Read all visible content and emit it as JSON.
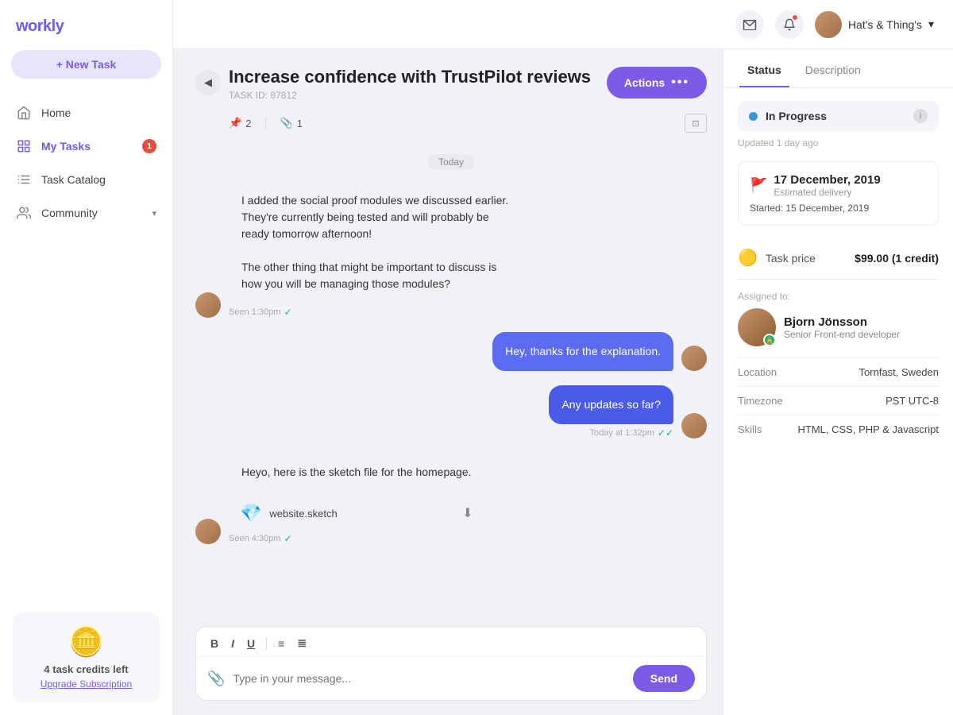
{
  "app": {
    "name": "workly"
  },
  "topbar": {
    "user_name": "Hat's & Thing's",
    "dropdown_icon": "▾"
  },
  "sidebar": {
    "new_task_label": "+ New Task",
    "nav_items": [
      {
        "id": "home",
        "label": "Home",
        "icon": "home",
        "badge": null,
        "active": false
      },
      {
        "id": "my-tasks",
        "label": "My Tasks",
        "icon": "tasks",
        "badge": "1",
        "active": true
      },
      {
        "id": "task-catalog",
        "label": "Task Catalog",
        "icon": "catalog",
        "badge": null,
        "active": false
      },
      {
        "id": "community",
        "label": "Community",
        "icon": "community",
        "badge": null,
        "active": false,
        "chevron": true
      }
    ],
    "footer": {
      "credits_count": "4",
      "credits_label": "task credits left",
      "upgrade_label": "Upgrade Subscription"
    }
  },
  "task": {
    "title": "Increase confidence with TrustPilot reviews",
    "id_label": "TASK ID: 87812",
    "pins_count": "2",
    "attachments_count": "1",
    "actions_label": "Actions"
  },
  "messages": [
    {
      "id": "msg1",
      "side": "left",
      "text": "I added the social proof modules we discussed earlier. They're currently being tested and will probably be ready tomorrow afternoon!\n\nThe other thing that might be important to discuss is how you will be managing those modules?",
      "status": "Seen 1:30pm",
      "has_check": true
    },
    {
      "id": "msg2",
      "side": "right",
      "text": "Hey, thanks for the explanation.",
      "status": null,
      "has_check": false
    },
    {
      "id": "msg3",
      "side": "right",
      "text": "Any updates so far?",
      "status": "Today at 1:32pm",
      "has_check": true
    },
    {
      "id": "msg4",
      "side": "left",
      "text": "Heyo, here is the sketch file for the homepage.",
      "file": {
        "name": "website.sketch",
        "icon": "💎"
      },
      "status": "Seen 4:30pm",
      "has_check": true
    }
  ],
  "date_separator": "Today",
  "message_input": {
    "placeholder": "Type in your message...",
    "send_label": "Send",
    "toolbar": {
      "bold": "B",
      "italic": "I",
      "underline": "U",
      "list": "≡",
      "ordered_list": "≣"
    }
  },
  "right_panel": {
    "tabs": [
      "Status",
      "Description"
    ],
    "active_tab": "Status",
    "status": {
      "label": "In Progress",
      "updated": "Updated 1 day ago"
    },
    "delivery": {
      "date": "17 December, 2019",
      "label": "Estimated delivery",
      "started_label": "Started:",
      "started_date": "15 December, 2019"
    },
    "price": {
      "label": "Task price",
      "value": "$99.00 (1 credit)"
    },
    "assigned": {
      "label": "Assigned to:",
      "name": "Bjorn Jönsson",
      "role": "Senior Front-end developer"
    },
    "details": [
      {
        "key": "Location",
        "value": "Tornfast, Sweden"
      },
      {
        "key": "Timezone",
        "value": "PST UTC-8"
      },
      {
        "key": "Skills",
        "value": "HTML, CSS, PHP & Javascript"
      }
    ]
  }
}
